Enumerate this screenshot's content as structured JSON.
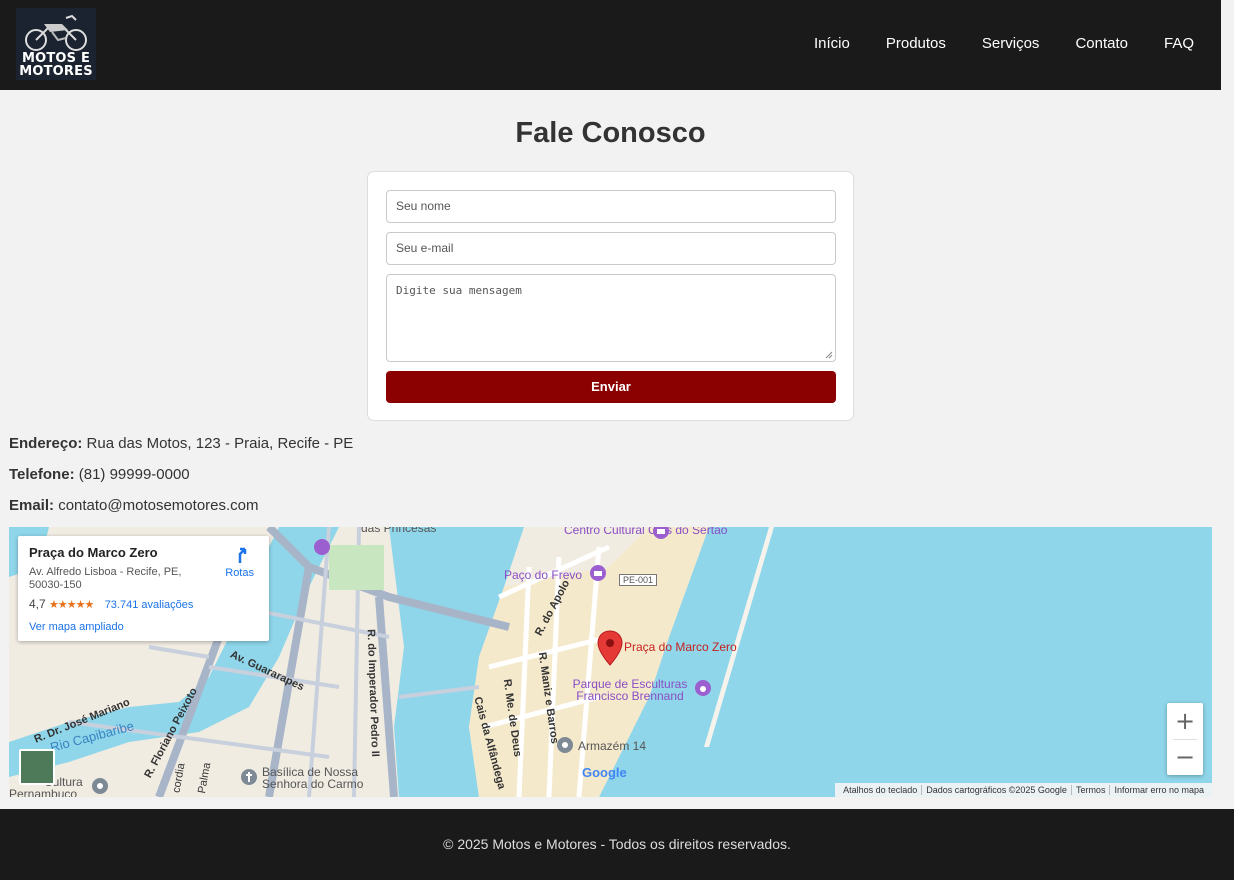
{
  "header": {
    "logo_text_line1": "MOTOS E",
    "logo_text_line2": "MOTORES",
    "nav": [
      "Início",
      "Produtos",
      "Serviços",
      "Contato",
      "FAQ"
    ]
  },
  "page_title": "Fale Conosco",
  "form": {
    "name_placeholder": "Seu nome",
    "email_placeholder": "Seu e-mail",
    "message_placeholder": "Digite sua mensagem",
    "submit_label": "Enviar"
  },
  "contact": {
    "address_label": "Endereço:",
    "address_value": "Rua das Motos, 123 - Praia, Recife - PE",
    "phone_label": "Telefone:",
    "phone_value": "(81) 99999-0000",
    "email_label": "Email:",
    "email_value": "contato@motosemotores.com"
  },
  "map": {
    "place_title": "Praça do Marco Zero",
    "place_address": "Av. Alfredo Lisboa - Recife, PE, 50030-150",
    "rating": "4,7",
    "stars": "★★★★★",
    "reviews": "73.741 avaliações",
    "larger_map_link": "Ver mapa ampliado",
    "directions_label": "Rotas",
    "pin_label": "Praça do Marco Zero",
    "poi": {
      "cais_sertao": "Centro Cultural Cais do Sertão",
      "paco_frevo": "Paço do Frevo",
      "pe001": "PE-001",
      "parque": "Parque de Esculturas Francisco Brennand",
      "armazem": "Armazém 14",
      "basilica": "Basílica de Nossa Senhora do Carmo",
      "princesas": "das Princesas",
      "cultura": "Cultura",
      "pernambuco": "Pernambuco",
      "rio": "Rio Capibaribe"
    },
    "streets": {
      "apolo": "R. do Apolo",
      "imperador": "R. do Imperador Pedro II",
      "guararapes": "Av. Guararapes",
      "jose_mariano": "R. Dr. José Mariano",
      "floriano": "R. Floriano Peixoto",
      "maniz": "R. Maniz e Barros",
      "me_deus": "R. Me. de Deus",
      "alfandega": "Cais da Alfândega",
      "palma": "Palma",
      "concordia": "cordia"
    },
    "zoom_in": "+",
    "zoom_out": "−",
    "google": "Google",
    "attribution": [
      "Atalhos do teclado",
      "Dados cartográficos ©2025 Google",
      "Termos",
      "Informar erro no mapa"
    ]
  },
  "footer": {
    "text": "© 2025 Motos e Motores - Todos os direitos reservados."
  }
}
